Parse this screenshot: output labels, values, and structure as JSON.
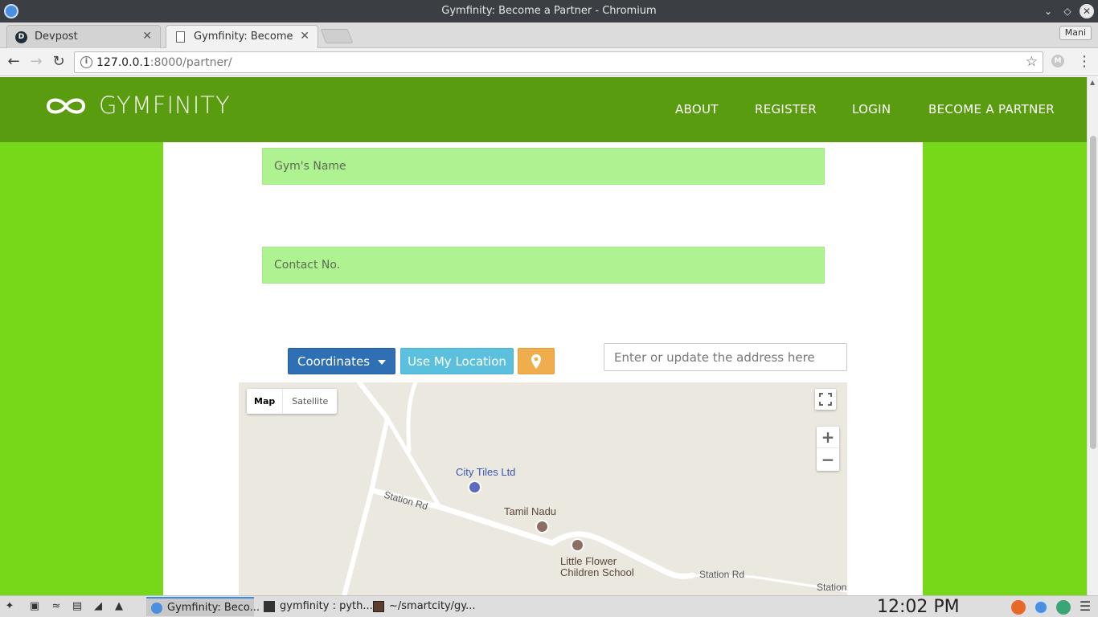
{
  "window": {
    "title": "Gymfinity: Become a Partner - Chromium"
  },
  "tabs": [
    {
      "label": "Devpost",
      "favicon": "D"
    },
    {
      "label": "Gymfinity: Become a P"
    }
  ],
  "profile": {
    "label": "Mani"
  },
  "address_bar": {
    "host": "127.0.0.1",
    "path": ":8000/partner/"
  },
  "site": {
    "brand": "GYMFINITY",
    "nav": [
      "ABOUT",
      "REGISTER",
      "LOGIN",
      "BECOME A PARTNER"
    ]
  },
  "form": {
    "gym_name_placeholder": "Gym's Name",
    "contact_placeholder": "Contact No.",
    "coordinates_label": "Coordinates",
    "use_location_label": "Use My Location",
    "address_placeholder": "Enter or update the address here"
  },
  "map": {
    "type_map": "Map",
    "type_satellite": "Satellite",
    "zoom_in": "+",
    "zoom_out": "−",
    "labels": {
      "city_tiles": "City Tiles Ltd",
      "station_rd_1": "Station Rd",
      "tamil_nadu": "Tamil Nadu",
      "school_line1": "Little Flower",
      "school_line2": "Children School",
      "station_rd_2": "Station Rd",
      "station_3": "Station"
    }
  },
  "taskbar": {
    "tasks": [
      "Gymfinity: Beco...",
      "gymfinity : pyth...",
      "~/smartcity/gy..."
    ],
    "clock": "12:02 PM"
  },
  "colors": {
    "header_green": "#5a9c10",
    "page_green": "#77d81a",
    "field_green": "#aff291",
    "btn_primary": "#2f70b5",
    "btn_info": "#5bc0de",
    "btn_warning": "#f0ad4e"
  }
}
